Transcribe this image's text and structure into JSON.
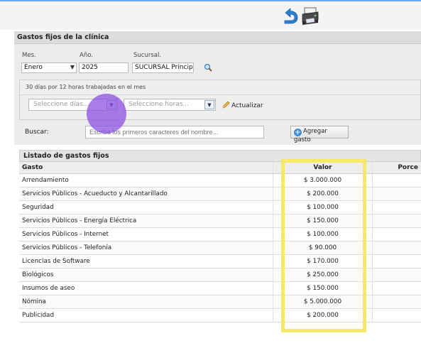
{
  "toolbar": {
    "back_icon": "undo-arrow-icon",
    "print_icon": "printer-icon",
    "accent": "#2f7fd0"
  },
  "panel": {
    "title": "Gastos fijos de la clínica",
    "month_label": "Mes.",
    "month_value": "Enero",
    "year_label": "Año.",
    "year_value": "2025",
    "branch_label": "Sucursal.",
    "branch_value": "SUCURSAL Principa",
    "info_text": "30 días por 12 horas trabajadas en el mes",
    "days_placeholder": "Seleccione días...",
    "hours_placeholder": "Seleccione horas...",
    "refresh_label": "Actualizar"
  },
  "search": {
    "label": "Buscar:",
    "placeholder": "Escriba los primeros caracteres del nombre...",
    "add_label": "Agregar gasto"
  },
  "list": {
    "title": "Listado de gastos fijos",
    "columns": [
      "Gasto",
      "Valor",
      "Porce"
    ],
    "rows": [
      {
        "name": "Arrendamiento",
        "value": "$ 3.000.000"
      },
      {
        "name": "Servicios Públicos - Acueducto y Alcantarillado",
        "value": "$ 200.000"
      },
      {
        "name": "Seguridad",
        "value": "$ 100.000"
      },
      {
        "name": "Servicios Públicos - Energía Eléctrica",
        "value": "$ 150.000"
      },
      {
        "name": "Servicios Públicos - Internet",
        "value": "$ 100.000"
      },
      {
        "name": "Servicios Públicos - Telefonía",
        "value": "$ 90.000"
      },
      {
        "name": "Licencias de Software",
        "value": "$ 170.000"
      },
      {
        "name": "Biológicos",
        "value": "$ 250.000"
      },
      {
        "name": "Insumos de aseo",
        "value": "$ 150.000"
      },
      {
        "name": "Nómina",
        "value": "$ 5.000.000"
      },
      {
        "name": "Publicidad",
        "value": "$ 200.000"
      }
    ]
  }
}
